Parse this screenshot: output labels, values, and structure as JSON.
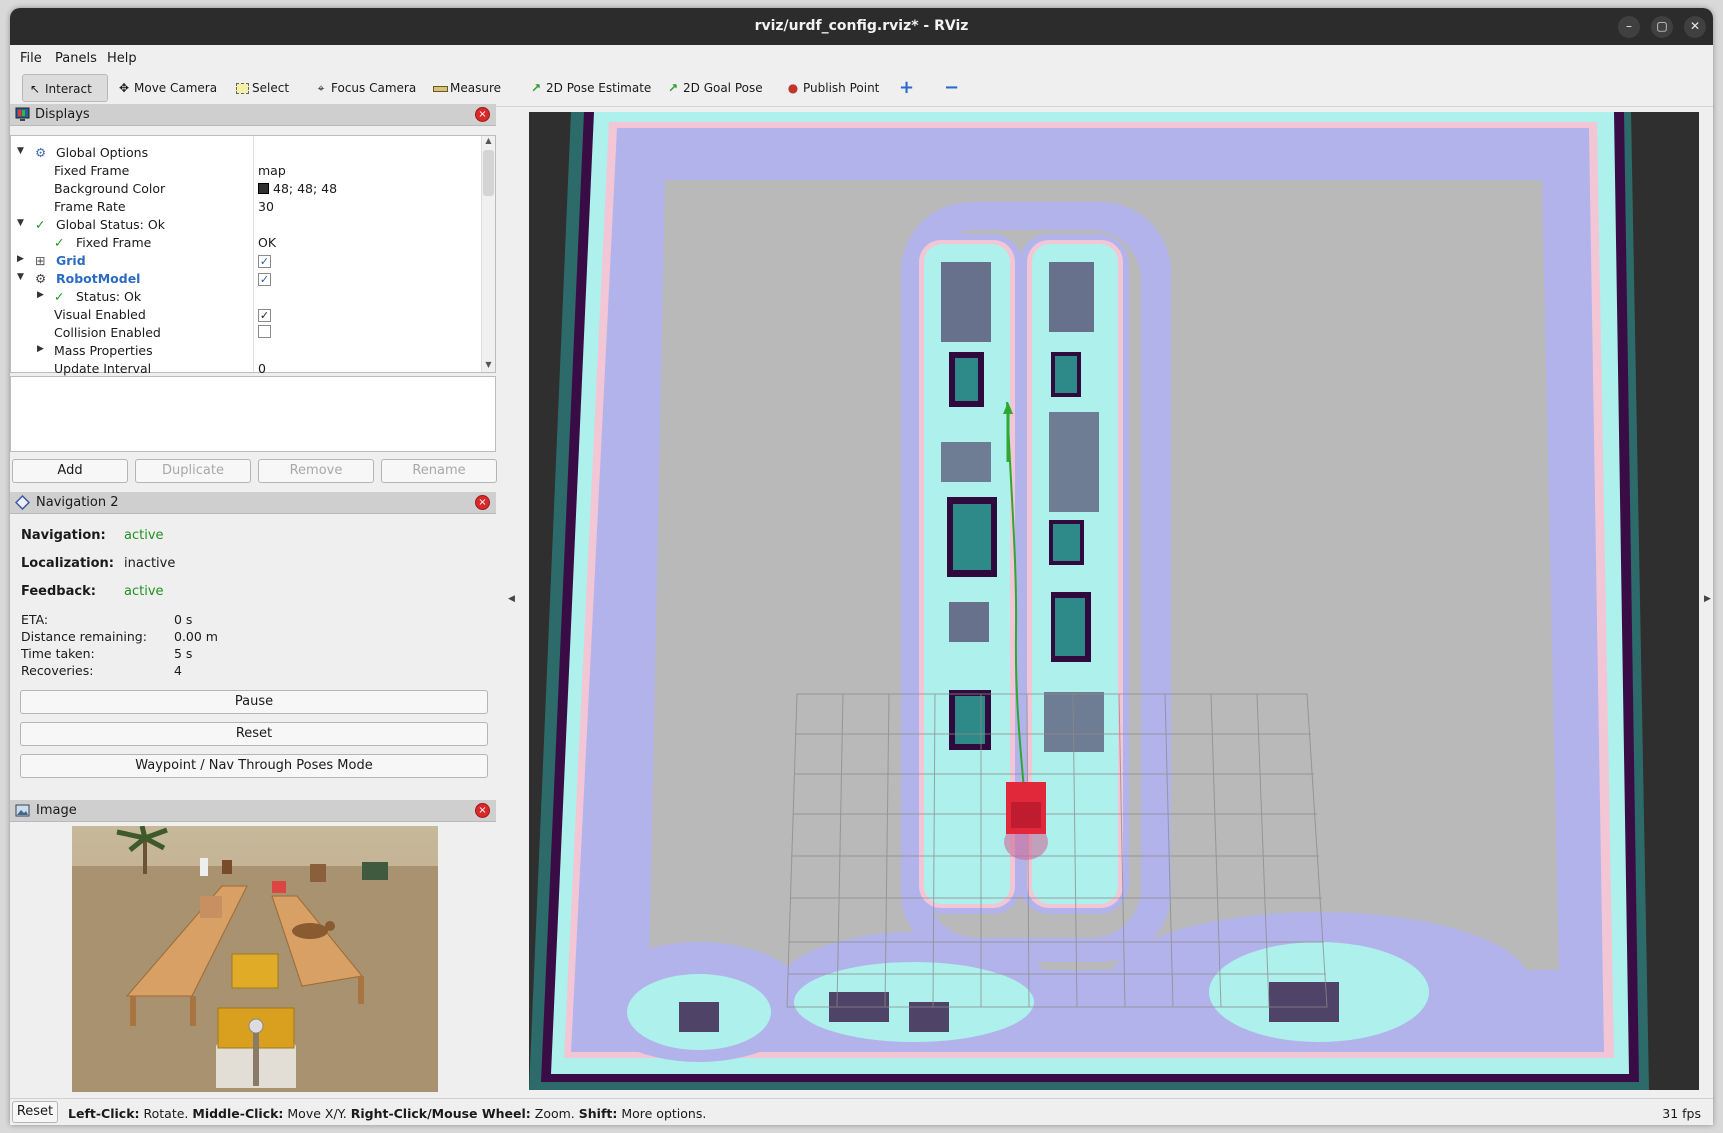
{
  "window": {
    "title": "rviz/urdf_config.rviz* - RViz",
    "minimize_glyph": "–",
    "maximize_glyph": "▢",
    "close_glyph": "✕"
  },
  "menu": {
    "items": [
      "File",
      "Panels",
      "Help"
    ]
  },
  "toolbar": {
    "tools": [
      {
        "label": "Interact",
        "icon": "cursor-icon",
        "active": true
      },
      {
        "label": "Move Camera",
        "icon": "move-camera-icon"
      },
      {
        "label": "Select",
        "icon": "select-icon"
      },
      {
        "label": "Focus Camera",
        "icon": "focus-camera-icon"
      },
      {
        "label": "Measure",
        "icon": "ruler-icon"
      },
      {
        "label": "2D Pose Estimate",
        "icon": "green-arrow-icon"
      },
      {
        "label": "2D Goal Pose",
        "icon": "green-arrow-icon"
      },
      {
        "label": "Publish Point",
        "icon": "map-pin-icon"
      }
    ],
    "add_tool_glyph": "+",
    "remove_tool_glyph": "−"
  },
  "displays": {
    "title": "Displays",
    "rows": [
      {
        "key": "Global Options",
        "value": ""
      },
      {
        "key": "Fixed Frame",
        "value": "map"
      },
      {
        "key": "Background Color",
        "value": "48; 48; 48"
      },
      {
        "key": "Frame Rate",
        "value": "30"
      },
      {
        "key": "Global Status: Ok",
        "value": ""
      },
      {
        "key": "Fixed Frame",
        "value": "OK"
      },
      {
        "key": "Grid",
        "value": ""
      },
      {
        "key": "RobotModel",
        "value": ""
      },
      {
        "key": "Status: Ok",
        "value": ""
      },
      {
        "key": "Visual Enabled",
        "value": ""
      },
      {
        "key": "Collision Enabled",
        "value": ""
      },
      {
        "key": "Mass Properties",
        "value": ""
      },
      {
        "key": "Update Interval",
        "value": "0"
      }
    ],
    "checks": {
      "grid": true,
      "robotmodel": true,
      "visual_enabled": true,
      "collision_enabled": false
    },
    "background_color_hex": "#303030",
    "buttons": {
      "add": "Add",
      "duplicate": "Duplicate",
      "remove": "Remove",
      "rename": "Rename"
    }
  },
  "navigation": {
    "title": "Navigation 2",
    "navigation_label": "Navigation:",
    "navigation_value": "active",
    "localization_label": "Localization:",
    "localization_value": "inactive",
    "feedback_label": "Feedback:",
    "feedback_value": "active",
    "eta_label": "ETA:",
    "eta_value": "0 s",
    "distance_label": "Distance remaining:",
    "distance_value": "0.00 m",
    "time_label": "Time taken:",
    "time_value": "5 s",
    "recoveries_label": "Recoveries:",
    "recoveries_value": "4",
    "pause_button": "Pause",
    "reset_button": "Reset",
    "mode_button": "Waypoint / Nav Through Poses Mode"
  },
  "image_panel": {
    "title": "Image"
  },
  "status_bar": {
    "reset_button": "Reset",
    "hint_parts": [
      {
        "text": "Left-Click:",
        "bold": true
      },
      {
        "text": " Rotate. ",
        "bold": false
      },
      {
        "text": "Middle-Click:",
        "bold": true
      },
      {
        "text": " Move X/Y. ",
        "bold": false
      },
      {
        "text": "Right-Click/Mouse Wheel:",
        "bold": true
      },
      {
        "text": " Zoom. ",
        "bold": false
      },
      {
        "text": "Shift:",
        "bold": true
      },
      {
        "text": " More options.",
        "bold": false
      }
    ],
    "fps": "31 fps"
  },
  "colors": {
    "costmap_purple": "#b3b3ec",
    "costmap_cyan": "#aef0ec",
    "lethal": "#300a3c",
    "free": "#b9b9b9",
    "robot_red": "#e0283a",
    "path_green": "#2ea82e",
    "inflation_pink": "#f3c6d6"
  }
}
